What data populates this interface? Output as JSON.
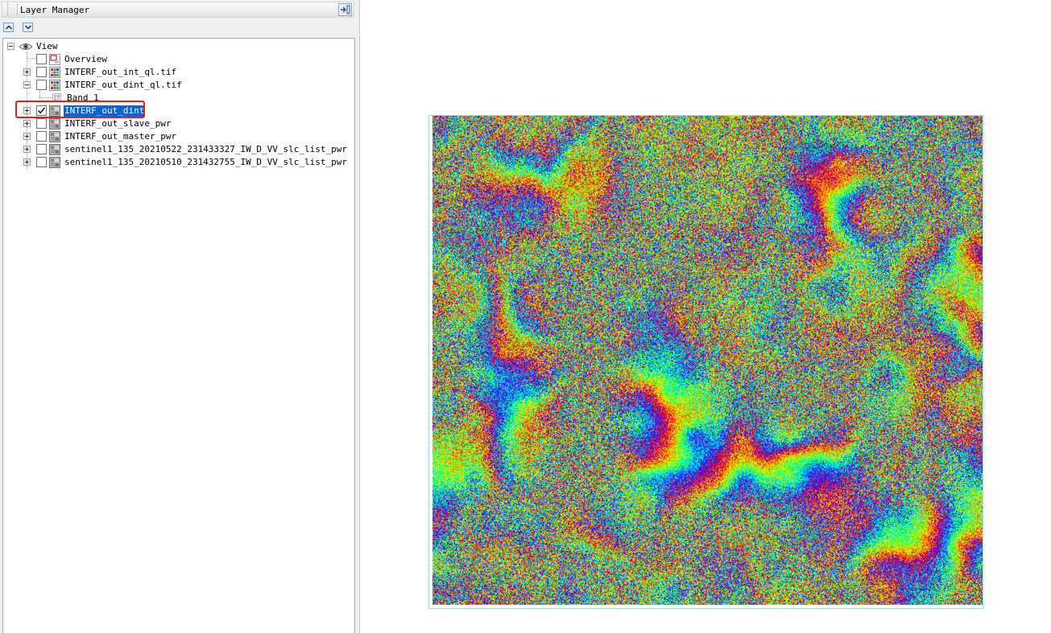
{
  "panel": {
    "title": "Layer Manager"
  },
  "toolbar": {
    "move_up_icon": "arrow-up-icon",
    "move_down_icon": "arrow-down-icon"
  },
  "tree": {
    "root": {
      "label": "View",
      "expanded": true,
      "icon": "eye-view-icon"
    },
    "items": [
      {
        "label": "Overview",
        "checked": false,
        "icon": "overview-icon",
        "expander": "none"
      },
      {
        "label": "INTERF_out_int_ql.tif",
        "checked": false,
        "icon": "color-raster-icon",
        "expander": "plus"
      },
      {
        "label": "INTERF_out_dint_ql.tif",
        "checked": false,
        "icon": "color-raster-icon",
        "expander": "minus",
        "children": [
          {
            "label": "Band 1",
            "icon": "band-icon"
          }
        ]
      },
      {
        "label": "INTERF_out_dint",
        "checked": true,
        "selected": true,
        "icon": "gray-raster-icon",
        "expander": "plus"
      },
      {
        "label": "INTERF_out_slave_pwr",
        "checked": false,
        "icon": "gray-raster-icon",
        "expander": "plus"
      },
      {
        "label": "INTERF_out_master_pwr",
        "checked": false,
        "icon": "gray-raster-icon",
        "expander": "plus"
      },
      {
        "label": "sentinel1_135_20210522_231433327_IW_D_VV_slc_list_pwr",
        "checked": false,
        "icon": "gray-raster-icon",
        "expander": "plus"
      },
      {
        "label": "sentinel1_135_20210510_231432755_IW_D_VV_slc_list_pwr",
        "checked": false,
        "icon": "gray-raster-icon",
        "expander": "plus"
      }
    ]
  },
  "colors": {
    "selection": "#0a64d6",
    "highlight_box": "#e3211b",
    "raster_palette": [
      "#0028ff",
      "#00b4ff",
      "#00ffd0",
      "#30ff30",
      "#c8ff00",
      "#ffd000",
      "#ff5a00",
      "#e00030",
      "#8000c0"
    ]
  },
  "map": {
    "raster_layer": "INTERF_out_dint",
    "rendering": "interferogram-phase-rainbow"
  }
}
